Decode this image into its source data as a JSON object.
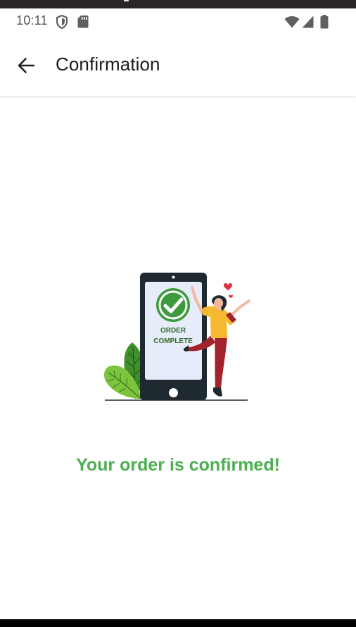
{
  "status_bar": {
    "time": "10:11",
    "icons": [
      "shield-icon",
      "sd-card-icon",
      "wifi-icon",
      "cell-signal-icon",
      "battery-icon"
    ]
  },
  "app_bar": {
    "back_icon": "arrow-left-icon",
    "title": "Confirmation"
  },
  "illustration": {
    "badge_line1": "ORDER",
    "badge_line2": "COMPLETE"
  },
  "message": "Your order is confirmed!",
  "colors": {
    "accent_green": "#4caf50",
    "phone_dark": "#1f2a30",
    "screen_light": "#e6ecf9",
    "shirt_yellow": "#f5b82e",
    "pants_red": "#a3232d",
    "leaf_green": "#6abf3a",
    "heart_red": "#e2313f"
  }
}
